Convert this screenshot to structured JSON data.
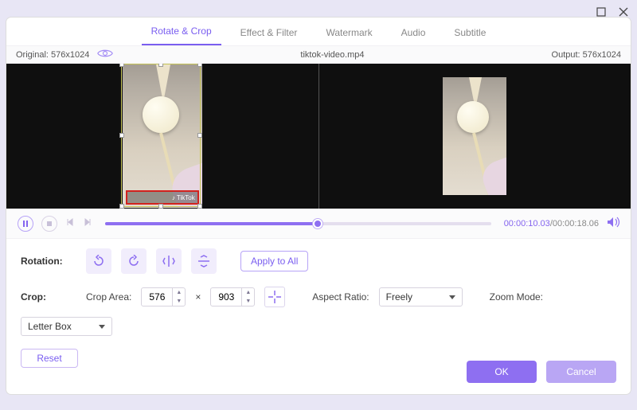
{
  "window": {
    "close": "×"
  },
  "tabs": [
    {
      "label": "Rotate & Crop",
      "active": true
    },
    {
      "label": "Effect & Filter",
      "active": false
    },
    {
      "label": "Watermark",
      "active": false
    },
    {
      "label": "Audio",
      "active": false
    },
    {
      "label": "Subtitle",
      "active": false
    }
  ],
  "header": {
    "original_label": "Original: 576x1024",
    "filename": "tiktok-video.mp4",
    "output_label": "Output: 576x1024"
  },
  "preview": {
    "watermark_text": "♪ TikTok"
  },
  "playback": {
    "current": "00:00:10.03",
    "sep": "/",
    "total": "00:00:18.06",
    "progress_pct": 55
  },
  "rotation": {
    "label": "Rotation:",
    "apply_all": "Apply to All"
  },
  "crop": {
    "label": "Crop:",
    "area_label": "Crop Area:",
    "w": "576",
    "x": "×",
    "h": "903",
    "aspect_label": "Aspect Ratio:",
    "aspect_value": "Freely",
    "zoom_label": "Zoom Mode:",
    "zoom_value": "Letter Box",
    "reset": "Reset"
  },
  "footer": {
    "ok": "OK",
    "cancel": "Cancel"
  }
}
